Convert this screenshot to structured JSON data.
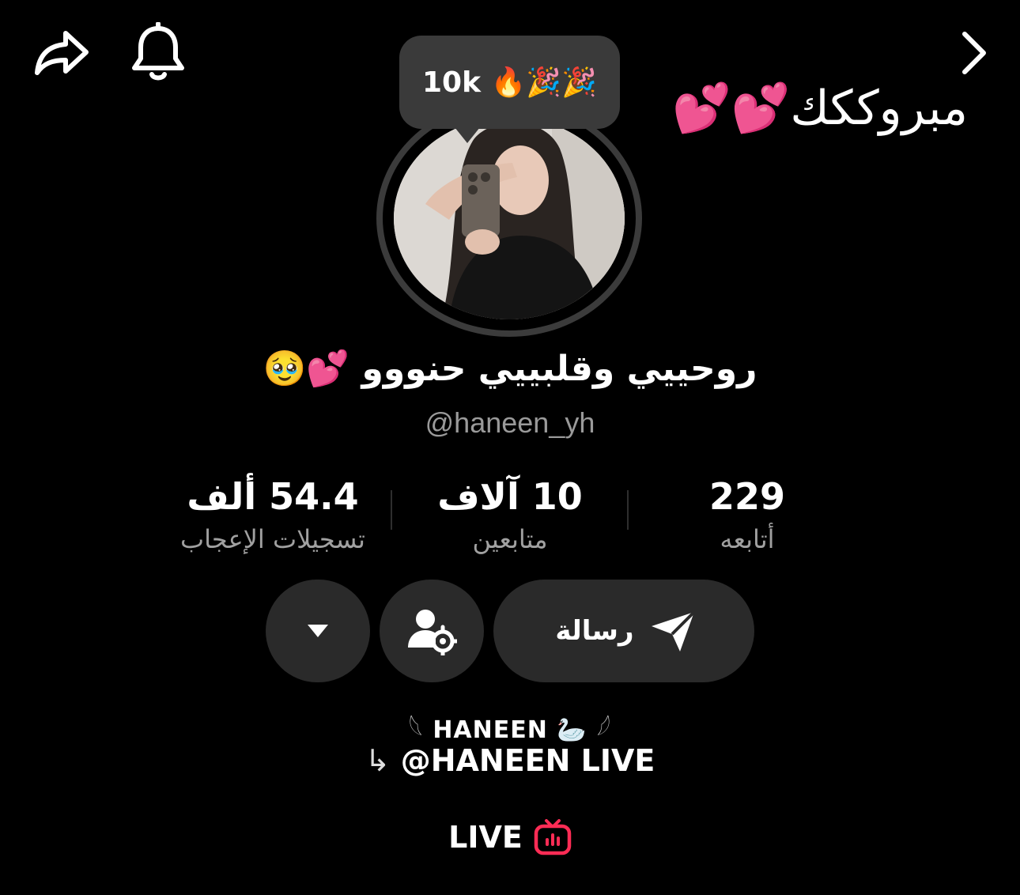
{
  "header": {
    "share_icon": "share-arrow-icon",
    "bell_icon": "bell-icon",
    "next_icon": "chevron-right-icon"
  },
  "celebration_text": "مبروككك💕💕",
  "bubble": {
    "text": "10k 🔥🎉🎉"
  },
  "profile": {
    "display_name": "روحييي وقلبييي حنووو 💕🥹",
    "username": "@haneen_yh"
  },
  "stats": {
    "following": {
      "value": "229",
      "label": "أتابعه"
    },
    "followers": {
      "value": "10 آلاف",
      "label": "متابعين"
    },
    "likes": {
      "value": "54.4 ألف",
      "label": "تسجيلات الإعجاب"
    }
  },
  "actions": {
    "message_label": "رسالة",
    "message_icon": "send-icon",
    "friends_icon": "user-settings-icon",
    "more_icon": "caret-down-icon"
  },
  "bio": {
    "line1": "HANEEN 🦢",
    "wing_left": "𓆩",
    "wing_right": "𓆪",
    "line2": "@HANEEN LIVE",
    "arrow": "↳"
  },
  "live": {
    "label": "LIVE",
    "icon": "live-tv-icon",
    "accent": "#fe2c55"
  },
  "colors": {
    "background": "#000000",
    "surface": "#2a2a2a",
    "muted_text": "#9a9a9a"
  }
}
